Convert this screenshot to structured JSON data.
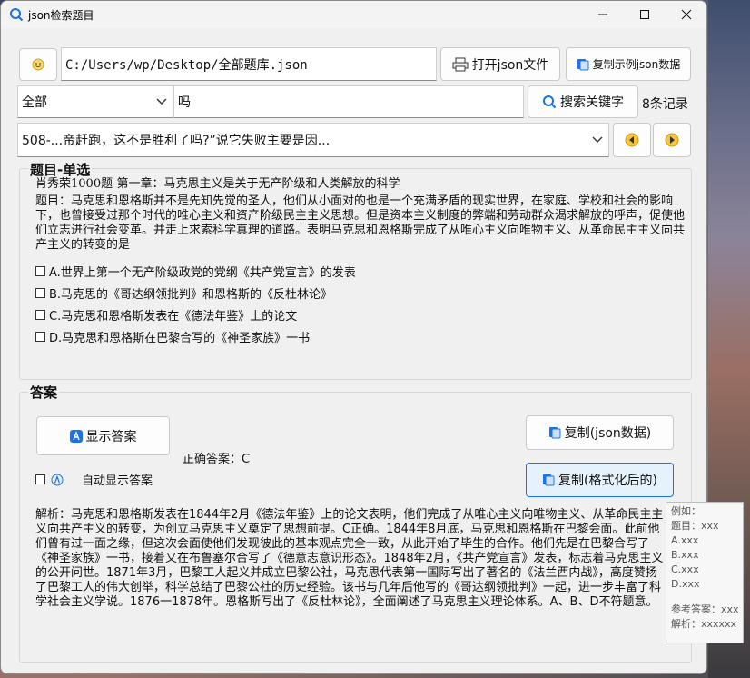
{
  "window": {
    "title": "json检索题目"
  },
  "toolbar": {
    "path_value": "C:/Users/wp/Desktop/全部题库.json",
    "open_json_label": "打开json文件",
    "copy_example_label": "复制示例json数据"
  },
  "search": {
    "category_selected": "全部",
    "keyword_value": "吗",
    "search_label": "搜索关键字",
    "record_count": "8条记录"
  },
  "result_select": {
    "selected": "508-...帝赶跑，这不是胜利了吗?”说它失败主要是因..."
  },
  "question": {
    "group_title": "题目-单选",
    "source": "肖秀荣1000题-第一章：马克思主义是关于无产阶级和人类解放的科学",
    "stem": "题目：马克思和恩格斯并不是先知先觉的圣人，他们从小面对的也是一个充满矛盾的现实世界，在家庭、学校和社会的影响下，也曾接受过那个时代的唯心主义和资产阶级民主主义思想。但是资本主义制度的弊端和劳动群众渴求解放的呼声，促使他们立志进行社会变革。并走上求索科学真理的道路。表明马克思和恩格斯完成了从唯心主义向唯物主义、从革命民主主义向共产主义的转变的是",
    "options": [
      "A.世界上第一个无产阶级政党的党纲《共产党宣言》的发表",
      "B.马克思的《哥达纲领批判》和恩格斯的《反杜林论》",
      "C.马克思和恩格斯发表在《德法年鉴》上的论文",
      "D.马克思和恩格斯在巴黎合写的《神圣家族》一书"
    ]
  },
  "answer": {
    "group_title": "答案",
    "show_answer_label": "显示答案",
    "correct_answer": "正确答案：C",
    "auto_show_label": "自动显示答案",
    "copy_json_label": "复制(json数据)",
    "copy_formatted_label": "复制(格式化后的)",
    "analysis": "解析：马克思和恩格斯发表在1844年2月《德法年鉴》上的论文表明，他们完成了从唯心主义向唯物主义、从革命民主主义向共产主义的转变，为创立马克思主义奠定了思想前提。C正确。1844年8月底，马克思和恩格斯在巴黎会面。此前他们曾有过一面之缘，但这次会面使他们发现彼此的基本观点完全一致，从此开始了毕生的合作。他们先是在巴黎合写了《神圣家族》一书，接着又在布鲁塞尔合写了《德意志意识形态》。1848年2月，《共产党宣言》发表，标志着马克思主义的公开问世。1871年3月，巴黎工人起义并成立巴黎公社，马克思代表第一国际写出了著名的《法兰西内战》，高度赞扬了巴黎工人的伟大创举，科学总结了巴黎公社的历史经验。该书与几年后他写的《哥达纲领批判》一起，进一步丰富了科学社会主义学说。1876一1878年。恩格斯写出了《反杜林论》，全面阐述了马克思主义理论体系。A、B、D不符题意。"
  },
  "tooltip": {
    "lines": [
      "例如：",
      "题目：xxx",
      "A.xxx",
      "B.xxx",
      "C.xxx",
      "D.xxx"
    ],
    "ref_answer": "参考答案：xxx",
    "analysis": "解析：xxxxxx"
  },
  "colors": {
    "accent": "#1a73e8",
    "icon_yellow": "#f5d76e"
  }
}
